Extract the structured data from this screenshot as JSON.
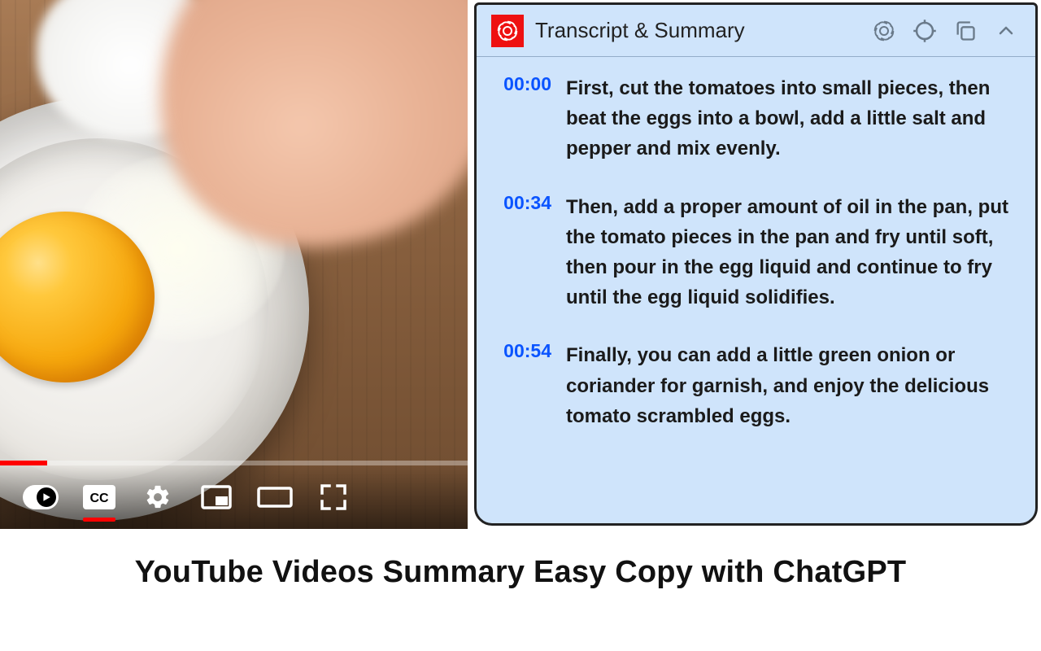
{
  "panel": {
    "title": "Transcript & Summary"
  },
  "transcript": [
    {
      "time": "00:00",
      "text": "First, cut the tomatoes into small pieces, then beat the eggs into a bowl, add a little salt and pepper and mix evenly."
    },
    {
      "time": "00:34",
      "text": "Then, add a proper amount of oil in the pan, put the tomato pieces in the pan and fry until soft, then pour in the egg liquid and continue to fry until the egg liquid solidifies."
    },
    {
      "time": "00:54",
      "text": "Finally, you can add a little green onion or coriander for garnish, and enjoy the delicious tomato scrambled eggs."
    }
  ],
  "caption": "YouTube Videos Summary Easy Copy with ChatGPT"
}
